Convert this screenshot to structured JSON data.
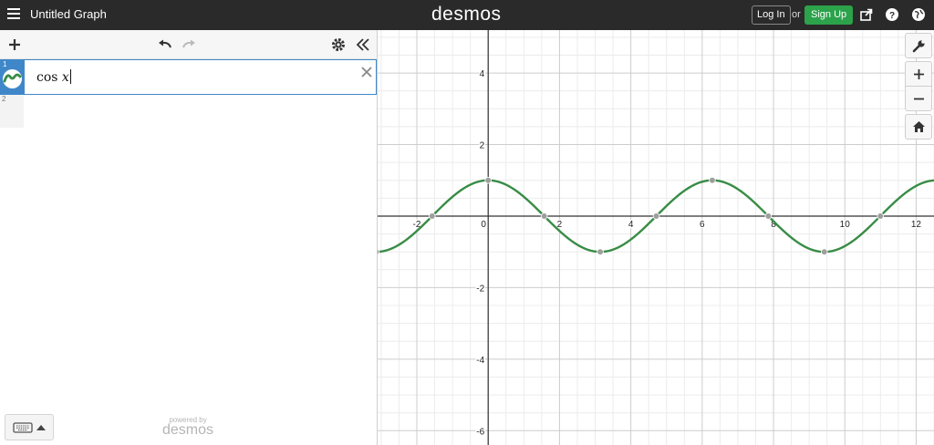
{
  "topbar": {
    "graph_title": "Untitled Graph",
    "logo": "desmos",
    "login_label": "Log In",
    "or_label": "or",
    "signup_label": "Sign Up",
    "icons": [
      "hamburger-menu-icon",
      "share-icon",
      "help-icon",
      "language-globe-icon"
    ]
  },
  "toolbar": {
    "icons": [
      "add-icon",
      "undo-icon",
      "redo-icon",
      "settings-gear-icon",
      "collapse-panel-icon"
    ]
  },
  "expressions": [
    {
      "index": "1",
      "latex_fn": "cos",
      "latex_var": "x",
      "color": "#388c46"
    },
    {
      "index": "2"
    }
  ],
  "footer": {
    "powered_by": "powered by",
    "logo": "desmos"
  },
  "graph": {
    "curve_color": "#388c46",
    "point_color": "#9e9e9e",
    "x_ticks": [
      "-2",
      "0",
      "2",
      "4",
      "6",
      "8",
      "10",
      "12"
    ],
    "y_ticks": [
      "4",
      "2",
      "-2",
      "-4",
      "-6"
    ],
    "icons": [
      "wrench-icon",
      "zoom-in-icon",
      "zoom-out-icon",
      "home-icon"
    ]
  },
  "chart_data": {
    "type": "line",
    "series": [
      {
        "expression": "cos x"
      }
    ],
    "xlim": [
      -3.1,
      12.5
    ],
    "ylim": [
      -6.4,
      5.2
    ],
    "grid": true,
    "points": [
      {
        "x": -3.1416,
        "y": -1
      },
      {
        "x": -1.5708,
        "y": 0
      },
      {
        "x": 0,
        "y": 1
      },
      {
        "x": 1.5708,
        "y": 0
      },
      {
        "x": 3.1416,
        "y": -1
      },
      {
        "x": 4.7124,
        "y": 0
      },
      {
        "x": 6.2832,
        "y": 1
      },
      {
        "x": 7.854,
        "y": 0
      },
      {
        "x": 9.4248,
        "y": -1
      },
      {
        "x": 10.9956,
        "y": 0
      }
    ]
  }
}
